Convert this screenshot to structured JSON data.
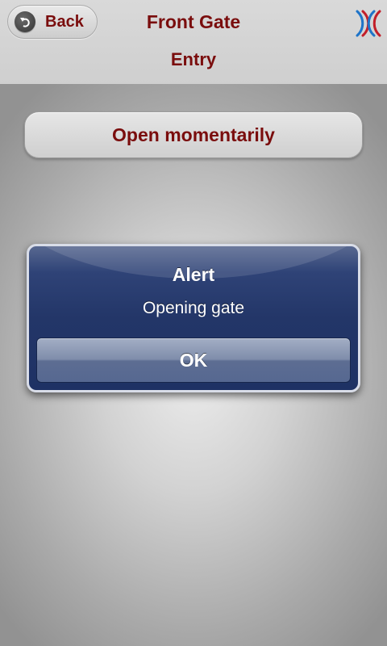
{
  "header": {
    "back_label": "Back",
    "title": "Front Gate",
    "subtitle": "Entry",
    "back_icon": "back-arrow-icon",
    "logo_icon": "app-logo-icon"
  },
  "main": {
    "action_label": "Open momentarily"
  },
  "alert": {
    "title": "Alert",
    "message": "Opening gate",
    "ok_label": "OK"
  },
  "colors": {
    "accent_text": "#7a0d0d",
    "alert_background": "#233668",
    "alert_text": "#ffffff"
  }
}
